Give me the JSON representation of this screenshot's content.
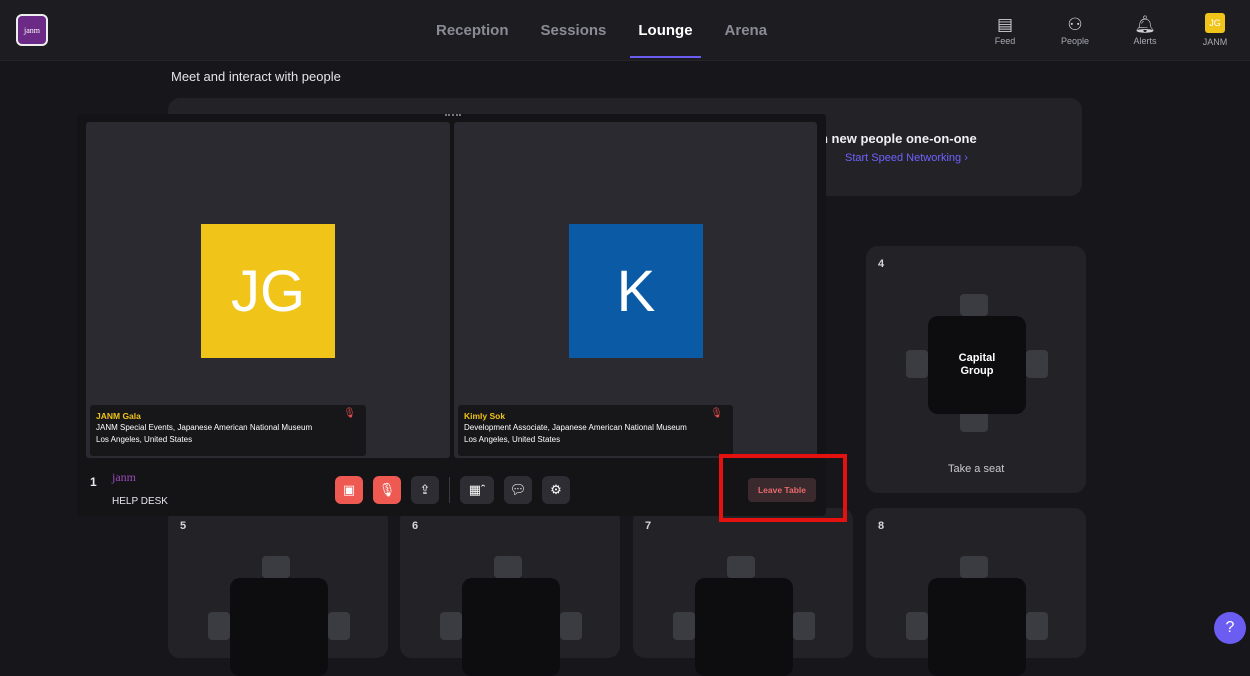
{
  "nav": {
    "logo_text": "janm",
    "tabs": [
      "Reception",
      "Sessions",
      "Lounge",
      "Arena"
    ],
    "active_tab": "Lounge",
    "icons": [
      {
        "label": "Feed",
        "icon": "feed-icon"
      },
      {
        "label": "People",
        "icon": "people-icon"
      },
      {
        "label": "Alerts",
        "icon": "bell-icon"
      },
      {
        "label": "JANM",
        "icon": "avatar",
        "initials": "JG"
      }
    ]
  },
  "lounge": {
    "subtitle": "Meet and interact with people",
    "banner_text": "h new people one-on-one",
    "banner_link": "Start Speed Networking  ›"
  },
  "tables": {
    "t4": {
      "number": "4",
      "name": "Capital\nGroup",
      "cta": "Take a seat"
    },
    "t5": {
      "number": "5"
    },
    "t6": {
      "number": "6"
    },
    "t7": {
      "number": "7"
    },
    "t8": {
      "number": "8"
    },
    "t1": {
      "number": "1",
      "logo": "janm",
      "name": "HELP DESK"
    }
  },
  "call": {
    "participants": [
      {
        "initials": "JG",
        "name": "JANM Gala",
        "title": "JANM Special Events, Japanese American National Museum",
        "location": "Los Angeles, United States",
        "color": "#f0c419"
      },
      {
        "initials": "K",
        "name": "Kimly Sok",
        "title": "Development Associate, Japanese American National Museum",
        "location": "Los Angeles, United States",
        "color": "#0a5aa6"
      }
    ],
    "leave_label": "Leave Table"
  },
  "help_label": "?"
}
